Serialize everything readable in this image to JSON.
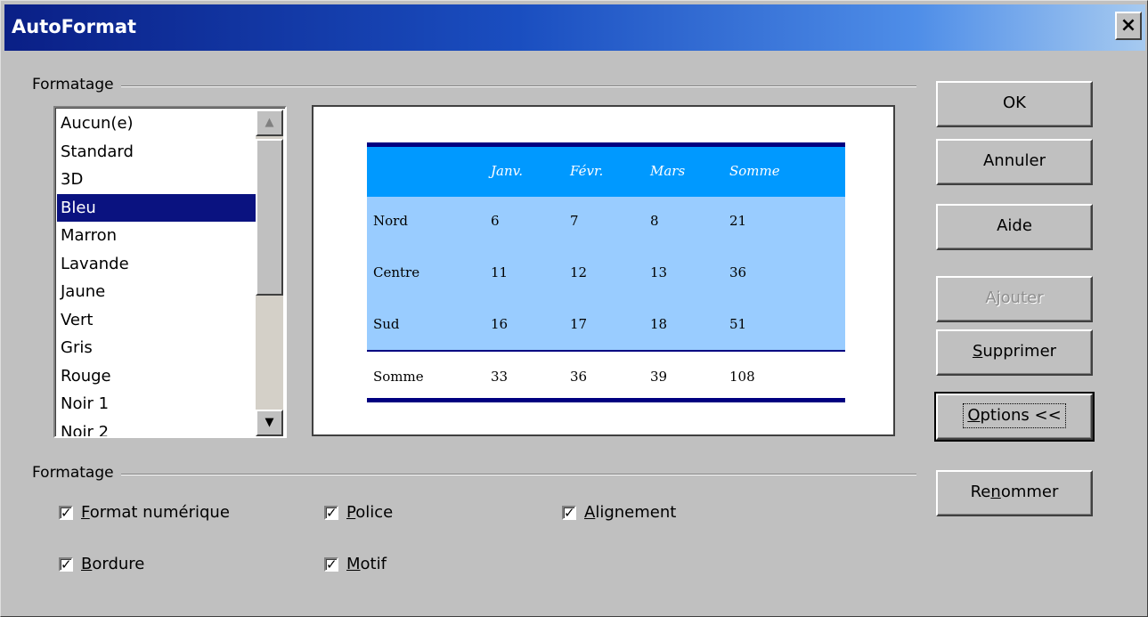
{
  "window": {
    "title": "AutoFormat",
    "close_glyph": "×"
  },
  "format_group": {
    "label": "Formatage"
  },
  "format_list": {
    "items": [
      "Aucun(e)",
      "Standard",
      "3D",
      "Bleu",
      "Marron",
      "Lavande",
      "Jaune",
      "Vert",
      "Gris",
      "Rouge",
      "Noir 1",
      "Noir 2"
    ],
    "selected_index": 3
  },
  "scrollbar": {
    "up_icon": "▲",
    "down_icon": "▼"
  },
  "preview": {
    "colors": {
      "header_bg": "#0099ff",
      "body_bg": "#99ccff",
      "border": "#000080"
    },
    "header": [
      "",
      "Janv.",
      "Févr.",
      "Mars",
      "Somme"
    ],
    "rows": [
      [
        "Nord",
        "6",
        "7",
        "8",
        "21"
      ],
      [
        "Centre",
        "11",
        "12",
        "13",
        "36"
      ],
      [
        "Sud",
        "16",
        "17",
        "18",
        "51"
      ]
    ],
    "total": [
      "Somme",
      "33",
      "36",
      "39",
      "108"
    ]
  },
  "buttons": {
    "ok": "OK",
    "cancel": "Annuler",
    "help": "Aide",
    "add": "Ajouter",
    "delete_u": "S",
    "delete_rest": "upprimer",
    "options_u": "O",
    "options_rest": "ptions <<",
    "rename_pre": "Re",
    "rename_u": "n",
    "rename_rest": "ommer"
  },
  "options_group": {
    "label": "Formatage",
    "checkboxes": [
      {
        "u": "F",
        "rest": "ormat numérique",
        "checked": true
      },
      {
        "u": "P",
        "rest": "olice",
        "checked": true
      },
      {
        "u": "A",
        "rest": "lignement",
        "checked": true
      },
      {
        "u": "B",
        "rest": "ordure",
        "checked": true
      },
      {
        "u": "M",
        "rest": "otif",
        "checked": true
      }
    ],
    "check_glyph": "✓"
  }
}
